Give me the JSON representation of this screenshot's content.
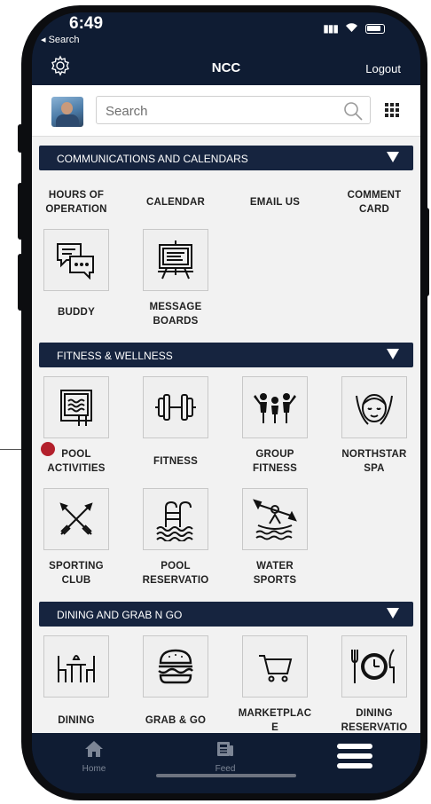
{
  "status": {
    "time": "6:49",
    "back": "◂ Search"
  },
  "header": {
    "title": "NCC",
    "logout": "Logout"
  },
  "search": {
    "placeholder": "Search"
  },
  "sections": [
    {
      "label": "COMMUNICATIONS AND CALENDARS"
    },
    {
      "label": "FITNESS & WELLNESS"
    },
    {
      "label": "DINING AND GRAB N GO"
    }
  ],
  "comm_row": [
    {
      "label": "HOURS OF\nOPERATION"
    },
    {
      "label": "CALENDAR"
    },
    {
      "label": "EMAIL US"
    },
    {
      "label": "COMMENT\nCARD"
    }
  ],
  "comm_tiles": [
    {
      "label": "BUDDY",
      "icon": "chat-bubbles-icon"
    },
    {
      "label": "MESSAGE\nBOARDS",
      "icon": "easel-board-icon"
    }
  ],
  "fitness_tiles": [
    {
      "label": "POOL\nACTIVITIES",
      "icon": "pool-ladder-icon"
    },
    {
      "label": "FITNESS",
      "icon": "dumbbell-icon"
    },
    {
      "label": "GROUP\nFITNESS",
      "icon": "group-people-icon"
    },
    {
      "label": "NORTHSTAR\nSPA",
      "icon": "spa-face-icon"
    },
    {
      "label": "SPORTING\nCLUB",
      "icon": "crossed-rifles-icon"
    },
    {
      "label": "POOL\nRESERVATIO",
      "icon": "pool-ladder-water-icon"
    },
    {
      "label": "WATER\nSPORTS",
      "icon": "kayak-icon"
    }
  ],
  "dining_tiles": [
    {
      "label": "DINING",
      "icon": "table-chairs-icon"
    },
    {
      "label": "GRAB & GO",
      "icon": "burger-icon"
    },
    {
      "label": "MARKETPLAC\nE",
      "icon": "cart-icon"
    },
    {
      "label": "DINING\nRESERVATIO",
      "icon": "plate-clock-icon"
    }
  ],
  "bottom_nav": {
    "home": "Home",
    "feed": "Feed"
  }
}
